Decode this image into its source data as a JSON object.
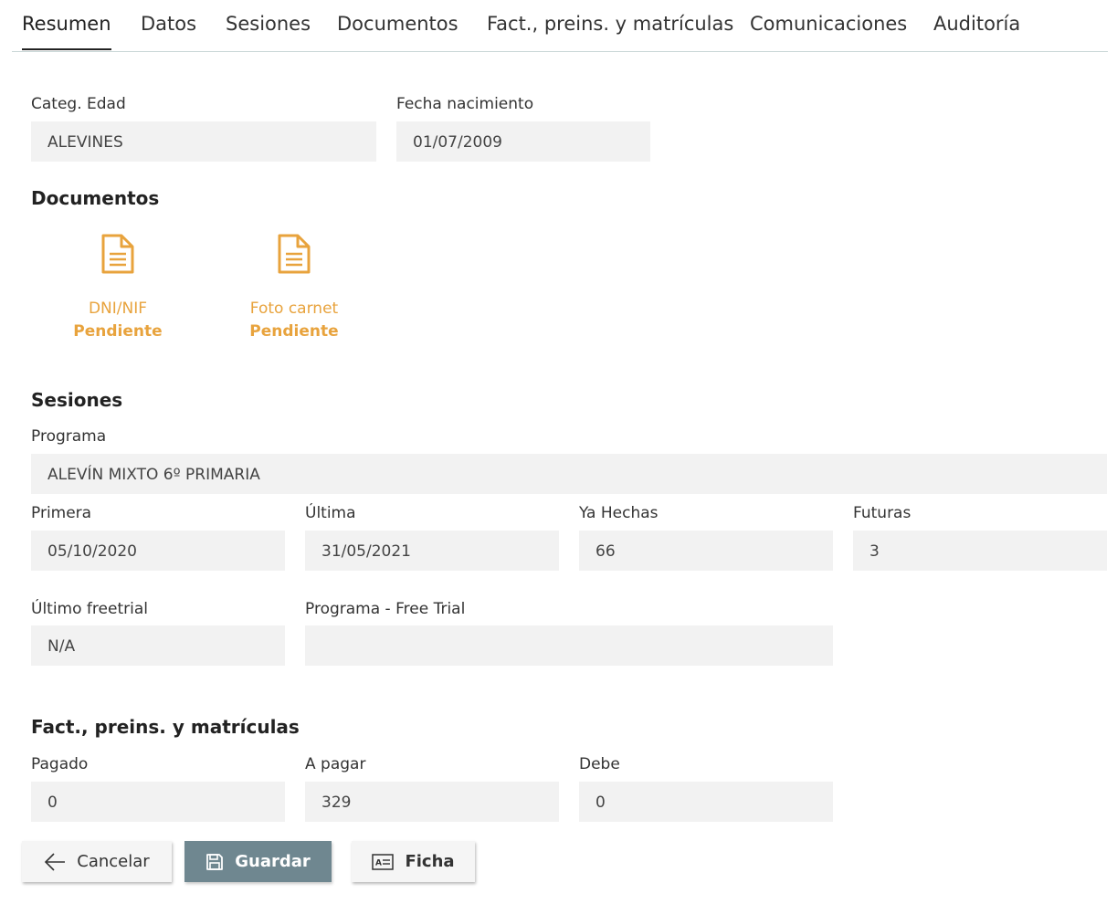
{
  "tabs": [
    {
      "label": "Resumen",
      "active": true
    },
    {
      "label": "Datos"
    },
    {
      "label": "Sesiones"
    },
    {
      "label": "Documentos"
    },
    {
      "label": "Fact., preins. y matrículas"
    },
    {
      "label": "Comunicaciones"
    },
    {
      "label": "Auditoría"
    }
  ],
  "general": {
    "categoria_label": "Categ. Edad",
    "categoria_value": "ALEVINES",
    "nacimiento_label": "Fecha nacimiento",
    "nacimiento_value": "01/07/2009"
  },
  "documentos": {
    "title": "Documentos",
    "items": [
      {
        "name": "DNI/NIF",
        "status": "Pendiente",
        "icon": "document-icon"
      },
      {
        "name": "Foto carnet",
        "status": "Pendiente",
        "icon": "document-icon"
      }
    ],
    "color": "#e8a33d"
  },
  "sesiones": {
    "title": "Sesiones",
    "programa_label": "Programa",
    "programa_value": "ALEVÍN MIXTO 6º PRIMARIA",
    "primera_label": "Primera",
    "primera_value": "05/10/2020",
    "ultima_label": "Última",
    "ultima_value": "31/05/2021",
    "hechas_label": "Ya Hechas",
    "hechas_value": "66",
    "futuras_label": "Futuras",
    "futuras_value": "3",
    "freetrial_label": "Último freetrial",
    "freetrial_value": "N/A",
    "prog_freetrial_label": "Programa - Free Trial",
    "prog_freetrial_value": ""
  },
  "facturacion": {
    "title": "Fact., preins. y matrículas",
    "pagado_label": "Pagado",
    "pagado_value": "0",
    "apagar_label": "A pagar",
    "apagar_value": "329",
    "debe_label": "Debe",
    "debe_value": "0"
  },
  "buttons": {
    "cancel_label": "Cancelar",
    "save_label": "Guardar",
    "ficha_label": "Ficha",
    "primary_color": "#6f8790"
  }
}
